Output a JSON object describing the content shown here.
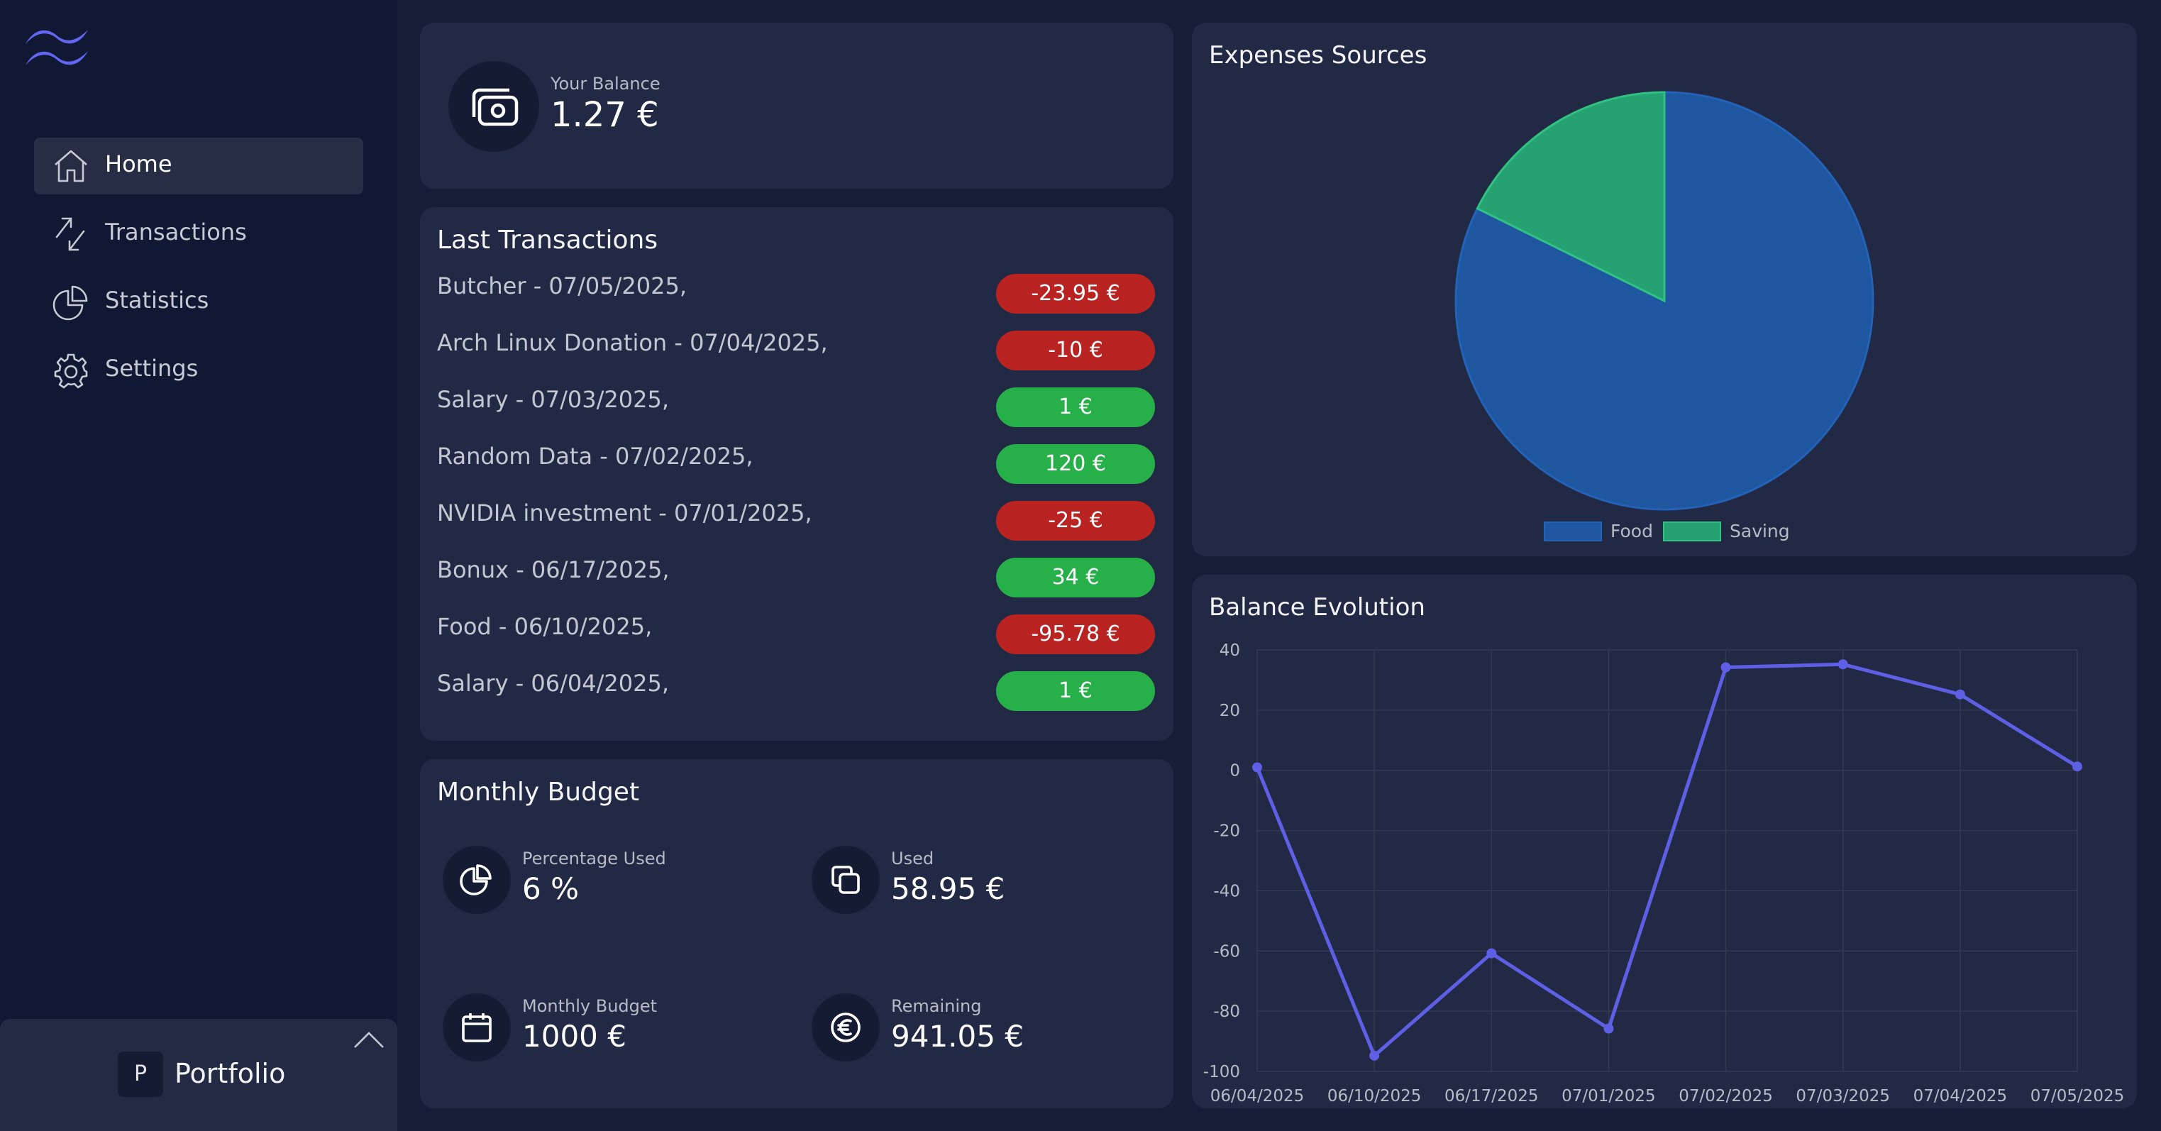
{
  "sidebar": {
    "logo": "tailwind-logo",
    "items": [
      {
        "label": "Home",
        "icon": "home-icon",
        "active": true
      },
      {
        "label": "Transactions",
        "icon": "transactions-icon",
        "active": false
      },
      {
        "label": "Statistics",
        "icon": "pie-chart-icon",
        "active": false
      },
      {
        "label": "Settings",
        "icon": "gear-icon",
        "active": false
      }
    ],
    "portfolio": {
      "avatar": "P",
      "name": "Portfolio",
      "icon": "chevron-up-icon"
    }
  },
  "balance": {
    "caption": "Your Balance",
    "value": "1.27 €",
    "icon": "money-icon"
  },
  "transactions": {
    "title": "Last Transactions",
    "items": [
      {
        "label": "Butcher - 07/05/2025,",
        "amount": "-23.95 €",
        "type": "neg"
      },
      {
        "label": "Arch Linux Donation - 07/04/2025,",
        "amount": "-10 €",
        "type": "neg"
      },
      {
        "label": "Salary - 07/03/2025,",
        "amount": "1 €",
        "type": "pos"
      },
      {
        "label": "Random Data - 07/02/2025,",
        "amount": "120 €",
        "type": "pos"
      },
      {
        "label": "NVIDIA investment - 07/01/2025,",
        "amount": "-25 €",
        "type": "neg"
      },
      {
        "label": "Bonux - 06/17/2025,",
        "amount": "34 €",
        "type": "pos"
      },
      {
        "label": "Food - 06/10/2025,",
        "amount": "-95.78 €",
        "type": "neg"
      },
      {
        "label": "Salary - 06/04/2025,",
        "amount": "1 €",
        "type": "pos"
      }
    ],
    "colors": {
      "neg": "#b92321",
      "pos": "#27b04a"
    }
  },
  "budget": {
    "title": "Monthly Budget",
    "stats": [
      {
        "caption": "Percentage Used",
        "value": "6 %",
        "icon": "pie-chart-icon"
      },
      {
        "caption": "Used",
        "value": "58.95 €",
        "icon": "copy-icon"
      },
      {
        "caption": "Monthly Budget",
        "value": "1000 €",
        "icon": "calendar-icon"
      },
      {
        "caption": "Remaining",
        "value": "941.05 €",
        "icon": "euro-icon"
      }
    ]
  },
  "expenses": {
    "title": "Expenses Sources"
  },
  "evolution": {
    "title": "Balance Evolution"
  },
  "chart_data": [
    {
      "type": "pie",
      "title": "Expenses Sources",
      "categories": [
        "Food",
        "Saving"
      ],
      "values": [
        82.3,
        17.7
      ],
      "colors": [
        "#1e56a0",
        "#26a272"
      ],
      "legend": "bottom"
    },
    {
      "type": "line",
      "title": "Balance Evolution",
      "categories": [
        "06/04/2025",
        "06/10/2025",
        "06/17/2025",
        "07/01/2025",
        "07/02/2025",
        "07/03/2025",
        "07/04/2025",
        "07/05/2025"
      ],
      "series": [
        {
          "values": [
            1,
            -94.78,
            -60.78,
            -85.78,
            34.22,
            35.22,
            25.22,
            1.27
          ],
          "color": "#5f5fe6"
        }
      ],
      "ylim": [
        -100,
        40
      ],
      "yticks": [
        40,
        20,
        0,
        -20,
        -40,
        -60,
        -80,
        -100
      ],
      "grid": true
    }
  ]
}
